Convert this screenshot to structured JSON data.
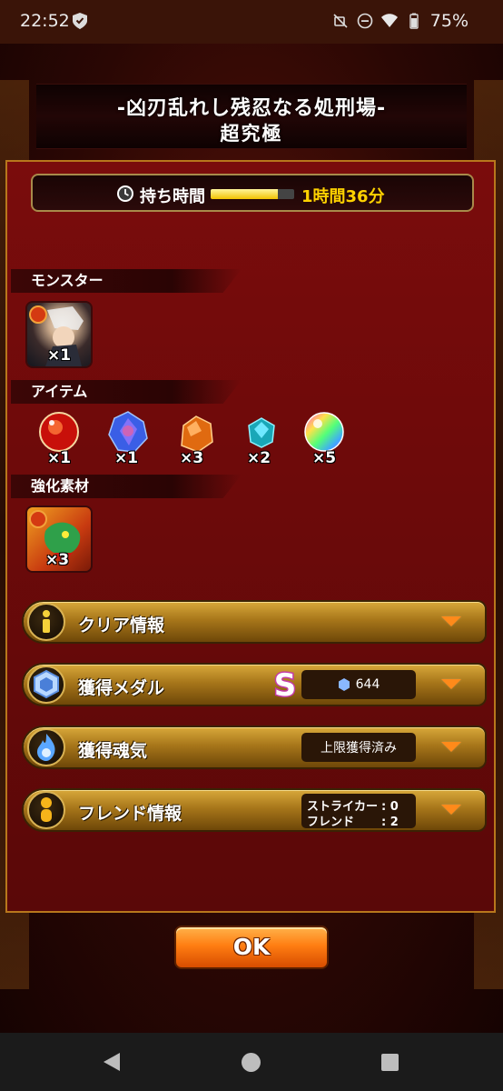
{
  "status_bar": {
    "time": "22:52",
    "battery": "75%",
    "icons": [
      "shield-icon",
      "mute-icon",
      "dnd-icon",
      "wifi-icon",
      "battery-icon"
    ]
  },
  "title": {
    "line1": "-凶刃乱れし残忍なる処刑場-",
    "line2": "超究極"
  },
  "time_limit": {
    "label": "持ち時間",
    "value": "1時間36分",
    "remaining_fraction": 0.8
  },
  "sections": {
    "monster": "モンスター",
    "item": "アイテム",
    "material": "強化素材"
  },
  "monster": {
    "qty": "×1"
  },
  "items": [
    {
      "name": "red-orb",
      "qty": "×1"
    },
    {
      "name": "blue-crystal",
      "qty": "×1"
    },
    {
      "name": "orange-stone",
      "qty": "×3"
    },
    {
      "name": "teal-gem",
      "qty": "×2"
    },
    {
      "name": "rainbow-orb",
      "qty": "×5"
    }
  ],
  "material": {
    "qty": "×3"
  },
  "rows": {
    "clear": {
      "label": "クリア情報"
    },
    "medal": {
      "label": "獲得メダル",
      "rank": "S",
      "value": "644"
    },
    "soul": {
      "label": "獲得魂気",
      "status": "上限獲得済み"
    },
    "friend": {
      "label": "フレンド情報",
      "striker_label": "ストライカー",
      "striker_value": "0",
      "friend_label": "フレンド",
      "friend_value": "2"
    }
  },
  "ok_label": "OK",
  "colors": {
    "accent_gold": "#d8a83a",
    "timer_text": "#ffd200",
    "chevron": "#ff8a1a"
  }
}
